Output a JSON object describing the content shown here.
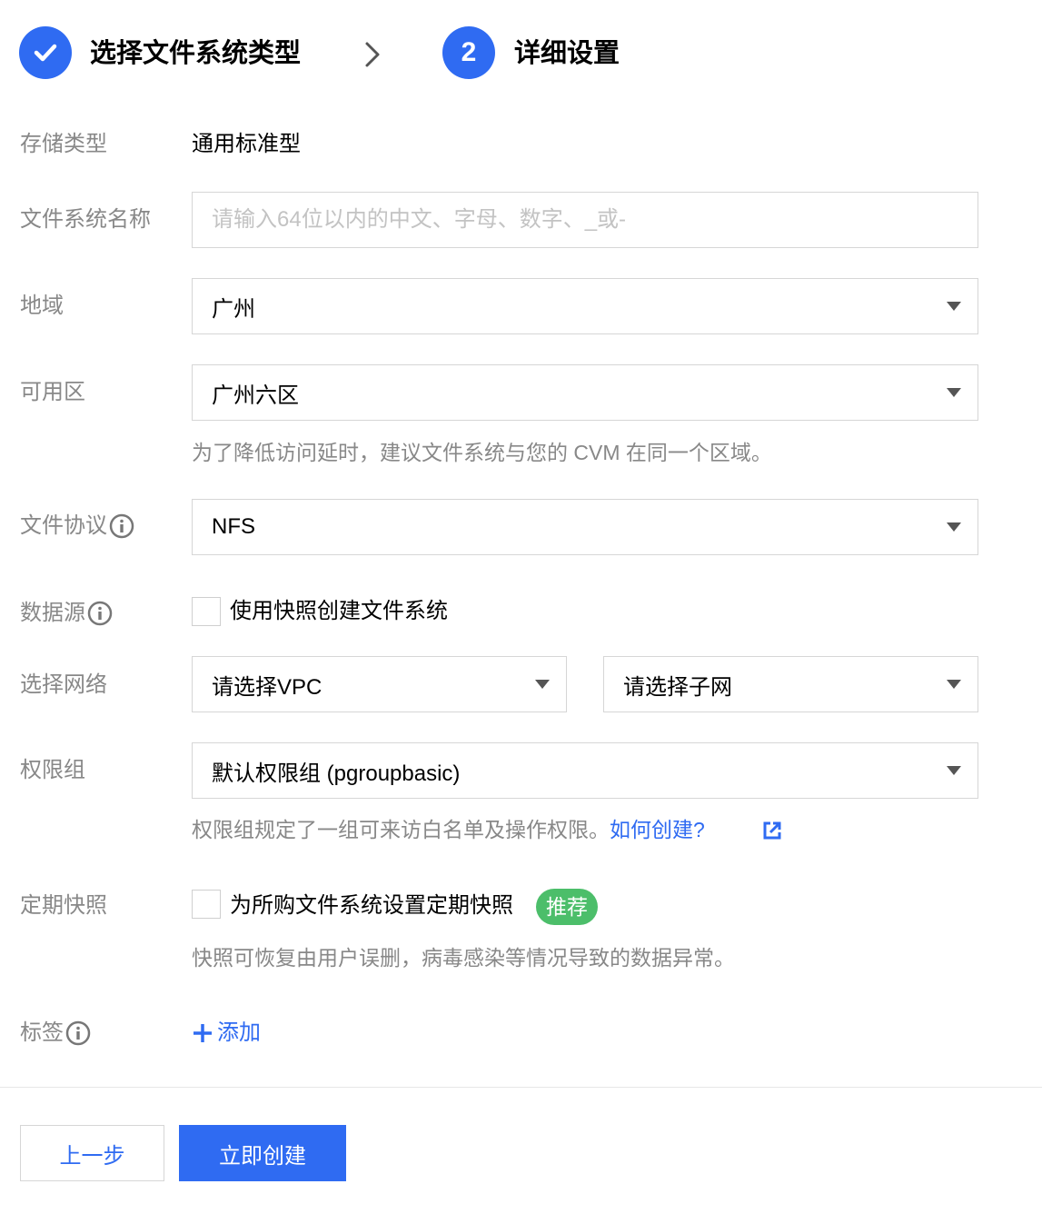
{
  "steps": [
    {
      "status": "done",
      "title": "选择文件系统类型"
    },
    {
      "number": "2",
      "title": "详细设置"
    }
  ],
  "form": {
    "storage_type": {
      "label": "存储类型",
      "value": "通用标准型"
    },
    "fs_name": {
      "label": "文件系统名称",
      "placeholder": "请输入64位以内的中文、字母、数字、_或-",
      "value": ""
    },
    "region": {
      "label": "地域",
      "selected": "广州"
    },
    "zone": {
      "label": "可用区",
      "selected": "广州六区",
      "hint": "为了降低访问延时，建议文件系统与您的 CVM 在同一个区域。"
    },
    "protocol": {
      "label": "文件协议",
      "selected": "NFS"
    },
    "data_source": {
      "label": "数据源",
      "checkbox_label": "使用快照创建文件系统",
      "checked": false
    },
    "network": {
      "label": "选择网络",
      "vpc_selected": "请选择VPC",
      "subnet_selected": "请选择子网"
    },
    "permission_group": {
      "label": "权限组",
      "selected": "默认权限组 (pgroupbasic)",
      "hint": "权限组规定了一组可来访白名单及操作权限。",
      "hint_link": "如何创建?"
    },
    "snapshot": {
      "label": "定期快照",
      "checkbox_label": "为所购文件系统设置定期快照",
      "checked": false,
      "badge": "推荐",
      "hint": "快照可恢复由用户误删，病毒感染等情况导致的数据异常。"
    },
    "tags": {
      "label": "标签",
      "add_label": "添加"
    }
  },
  "footer": {
    "prev_label": "上一步",
    "create_label": "立即创建"
  },
  "colors": {
    "primary": "#2f6bf2",
    "badge": "#4cbe6a",
    "label": "#888888",
    "border": "#d6d6d6"
  },
  "icons": [
    "check-icon",
    "chevron-right-icon",
    "info-icon",
    "caret-down-icon",
    "external-link-icon",
    "plus-icon"
  ]
}
